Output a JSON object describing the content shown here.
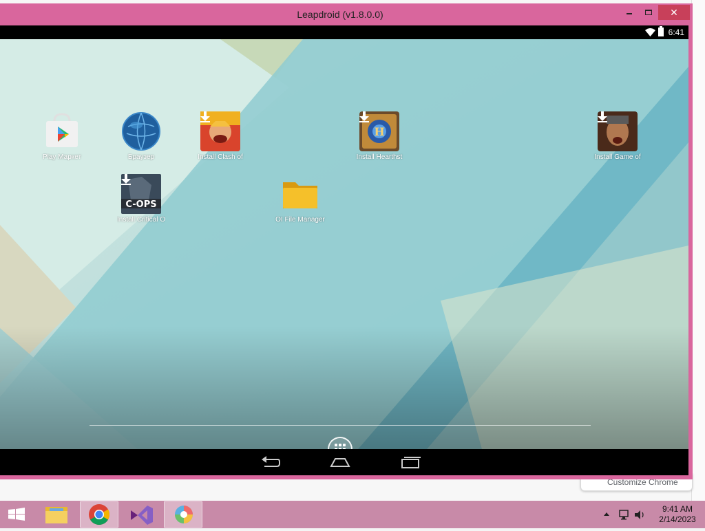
{
  "window": {
    "title": "Leapdroid (v1.8.0.0)",
    "close_glyph": "✕"
  },
  "status_bar": {
    "time": "6:41",
    "icons": [
      "wifi-icon",
      "battery-icon"
    ]
  },
  "desktop_apps": [
    {
      "label": "Play Маркет",
      "icon": "play-store-icon"
    },
    {
      "label": "Браузер",
      "icon": "browser-globe-icon"
    },
    {
      "label": "Install Clash of",
      "icon": "clash-of-clans-icon"
    },
    {
      "label": "Install Hearthst",
      "icon": "hearthstone-icon"
    },
    {
      "label": "Install Game of",
      "icon": "game-of-war-icon"
    },
    {
      "label": "Install Critical O",
      "icon": "critical-ops-icon"
    },
    {
      "label": "OI File Manager",
      "icon": "folder-icon"
    }
  ],
  "critical_ops_logo": "C-OPS",
  "nav_buttons": [
    "back-icon",
    "home-icon",
    "recents-icon"
  ],
  "background_window": {
    "customize_label": "Customize Chrome"
  },
  "taskbar": {
    "items": [
      "windows-start-icon",
      "file-explorer-icon",
      "chrome-icon",
      "visual-studio-icon",
      "leapdroid-icon"
    ],
    "tray_icons": [
      "show-hidden-icons-chevron",
      "network-icon",
      "volume-icon"
    ],
    "time": "9:41 AM",
    "date": "2/14/2023"
  },
  "colors": {
    "window_frame": "#d9669d",
    "close_button": "#c8405a",
    "taskbar": "#c88aa8"
  }
}
